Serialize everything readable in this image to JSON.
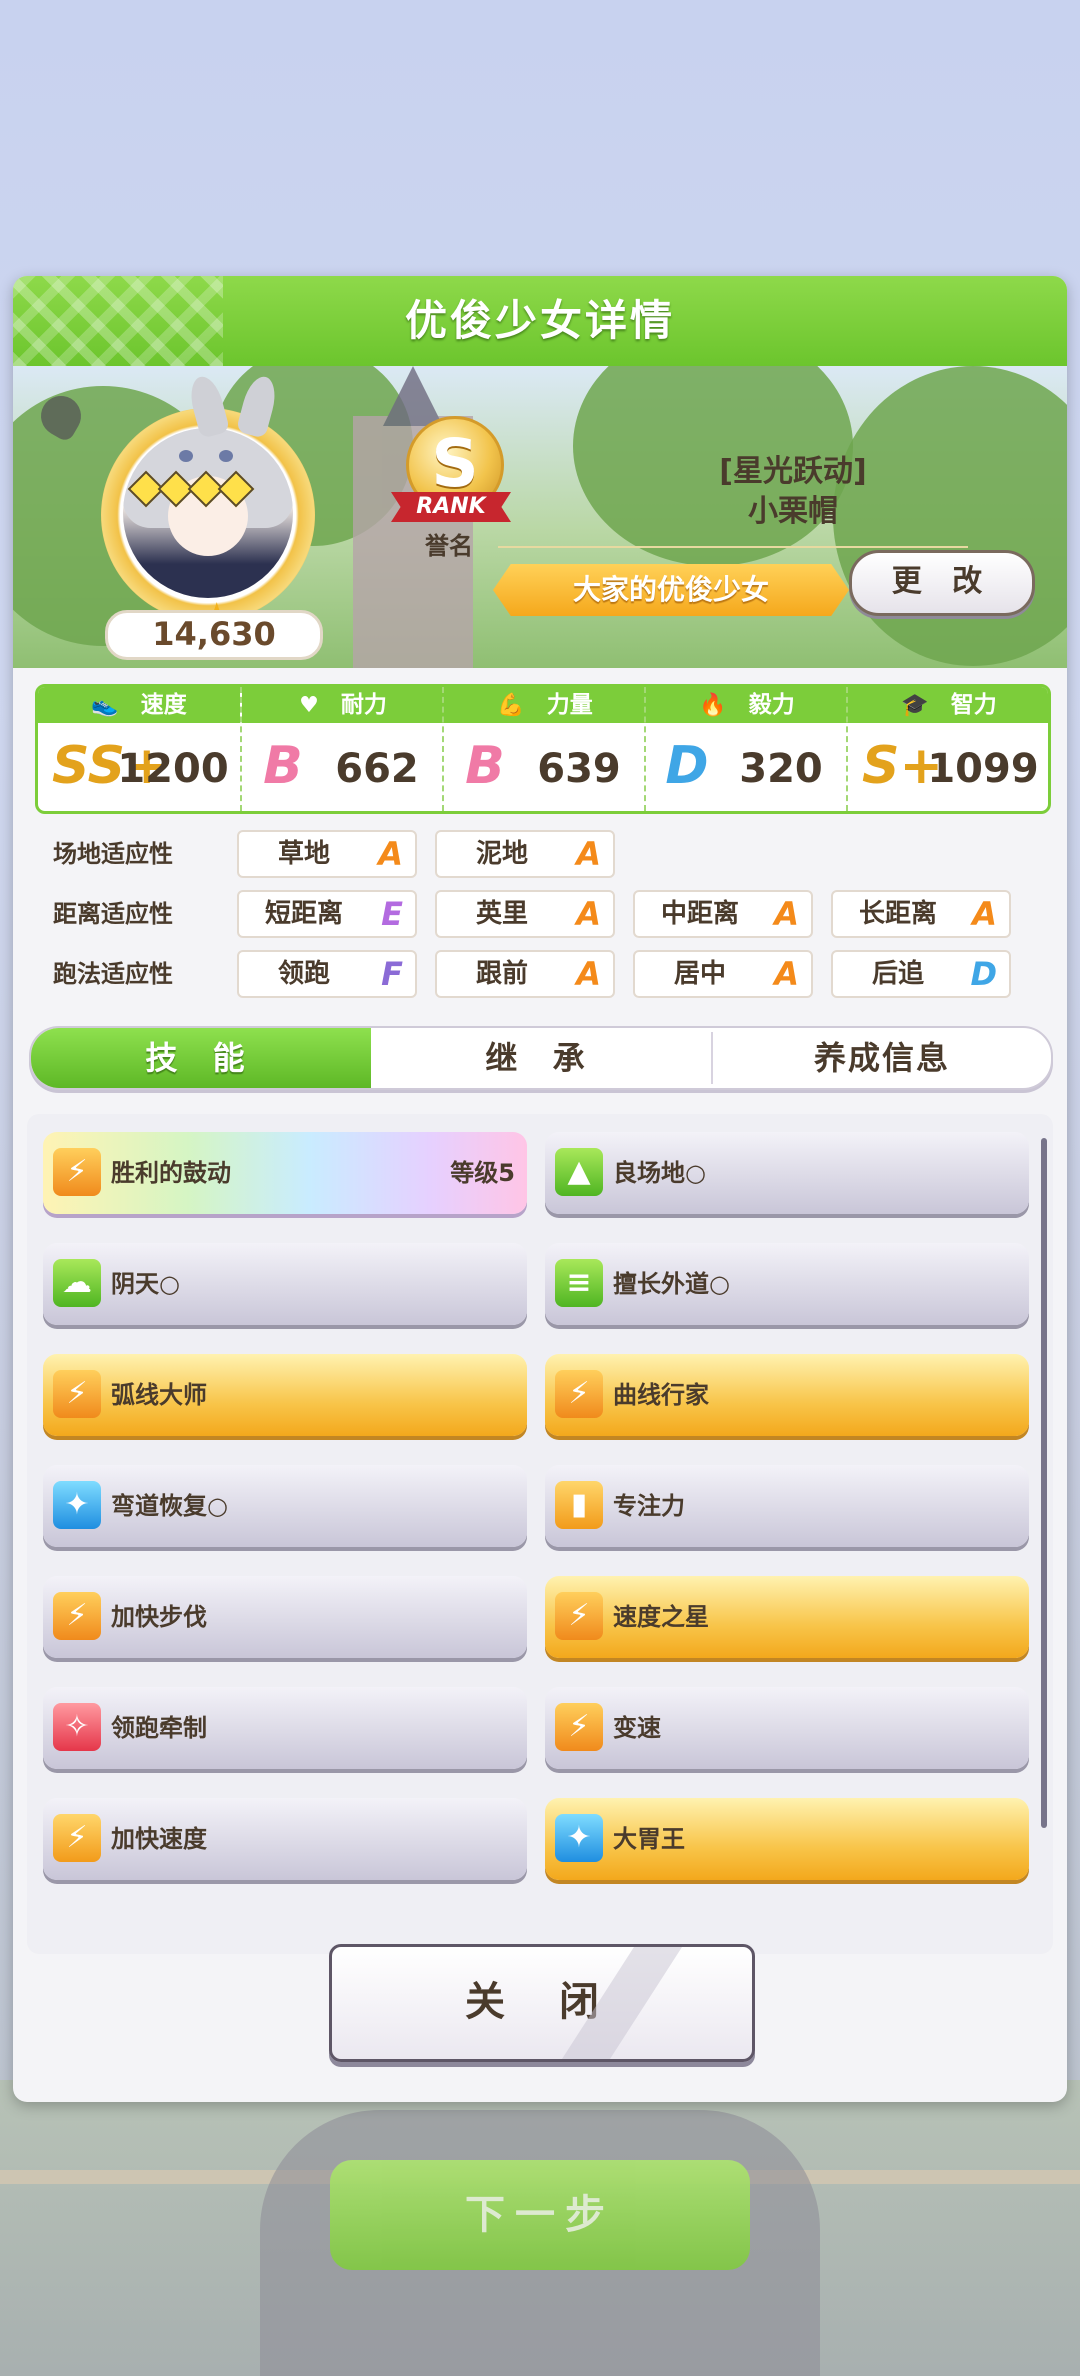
{
  "header": {
    "title": "优俊少女详情"
  },
  "character": {
    "fans": "14,630",
    "rank_letter": "S",
    "rank_word": "RANK",
    "epithet_label": "誉名",
    "outfit_line1": "[星光跃动]",
    "outfit_line2": "小栗帽",
    "epithet": "大家的优俊少女",
    "change_label": "更 改"
  },
  "stats": [
    {
      "label": "速度",
      "grade": "SS+",
      "value": "1200",
      "color": "#e3a21c"
    },
    {
      "label": "耐力",
      "grade": "B",
      "value": "662",
      "color": "#f07aa6"
    },
    {
      "label": "力量",
      "grade": "B",
      "value": "639",
      "color": "#f07aa6"
    },
    {
      "label": "毅力",
      "grade": "D",
      "value": "320",
      "color": "#3fa6e6"
    },
    {
      "label": "智力",
      "grade": "S+",
      "value": "1099",
      "color": "#e3a21c"
    }
  ],
  "aptitudes": {
    "terrain": {
      "label": "场地适应性",
      "items": [
        {
          "name": "草地",
          "grade": "A"
        },
        {
          "name": "泥地",
          "grade": "A"
        }
      ]
    },
    "distance": {
      "label": "距离适应性",
      "items": [
        {
          "name": "短距离",
          "grade": "E"
        },
        {
          "name": "英里",
          "grade": "A"
        },
        {
          "name": "中距离",
          "grade": "A"
        },
        {
          "name": "长距离",
          "grade": "A"
        }
      ]
    },
    "style": {
      "label": "跑法适应性",
      "items": [
        {
          "name": "领跑",
          "grade": "F"
        },
        {
          "name": "跟前",
          "grade": "A"
        },
        {
          "name": "居中",
          "grade": "A"
        },
        {
          "name": "后追",
          "grade": "D"
        }
      ]
    }
  },
  "grade_colors": {
    "A": "#f48a1a",
    "D": "#3fa6e6",
    "E": "#b36be0",
    "F": "#8b6bd6"
  },
  "tabs": [
    {
      "label": "技 能"
    },
    {
      "label": "继 承"
    },
    {
      "label": "养成信息"
    }
  ],
  "skills": [
    {
      "name": "胜利的鼓动",
      "level": "等级5",
      "style": "rainbow",
      "icon": "speed"
    },
    {
      "name": "良场地○",
      "level": "",
      "style": "silver",
      "icon": "green"
    },
    {
      "name": "阴天○",
      "level": "",
      "style": "silver",
      "icon": "green"
    },
    {
      "name": "擅长外道○",
      "level": "",
      "style": "silver",
      "icon": "green"
    },
    {
      "name": "弧线大师",
      "level": "",
      "style": "gold",
      "icon": "speed"
    },
    {
      "name": "曲线行家",
      "level": "",
      "style": "gold",
      "icon": "speed"
    },
    {
      "name": "弯道恢复○",
      "level": "",
      "style": "silver",
      "icon": "blue"
    },
    {
      "name": "专注力",
      "level": "",
      "style": "silver",
      "icon": "orange"
    },
    {
      "name": "加快步伐",
      "level": "",
      "style": "silver",
      "icon": "speed"
    },
    {
      "name": "速度之星",
      "level": "",
      "style": "gold",
      "icon": "speed"
    },
    {
      "name": "领跑牵制",
      "level": "",
      "style": "silver",
      "icon": "red"
    },
    {
      "name": "变速",
      "level": "",
      "style": "silver",
      "icon": "speed"
    },
    {
      "name": "加快速度",
      "level": "",
      "style": "silver",
      "icon": "speed"
    },
    {
      "name": "大胃王",
      "level": "",
      "style": "gold",
      "icon": "blue"
    }
  ],
  "close_label": "关 闭",
  "next_label": "下一步"
}
